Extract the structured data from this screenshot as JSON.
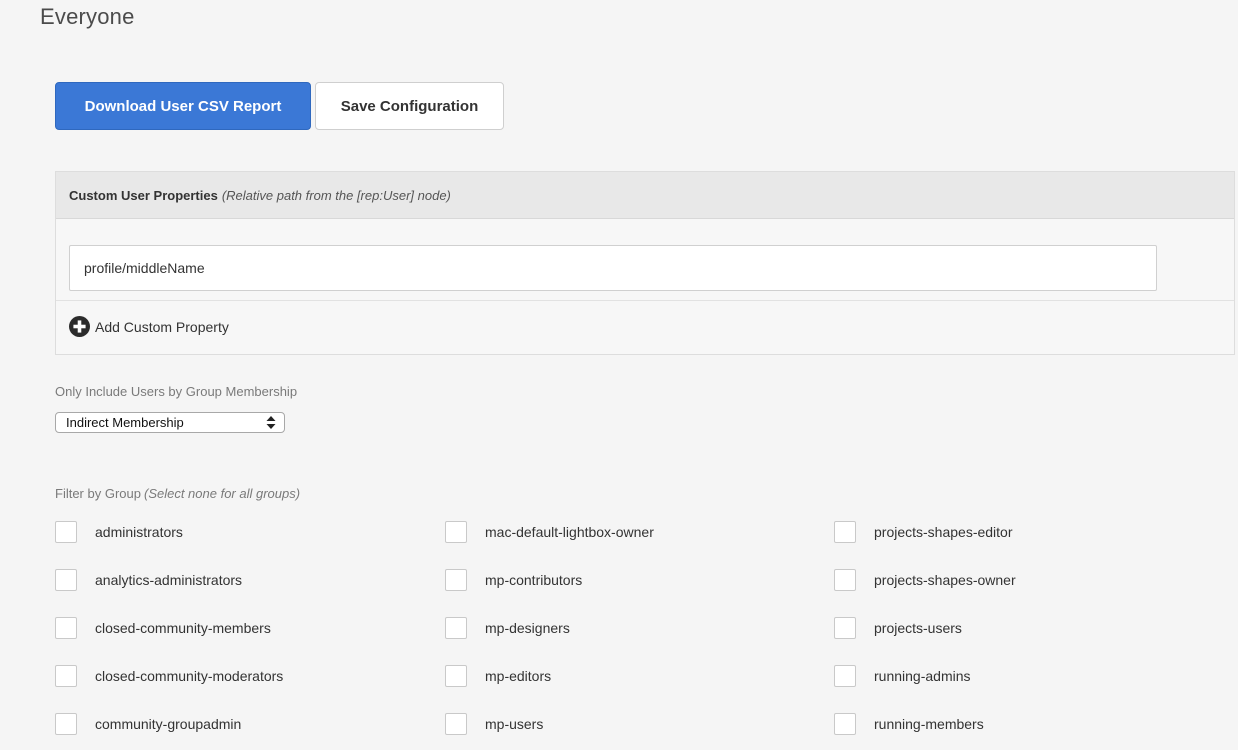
{
  "page": {
    "title": "Everyone"
  },
  "actions": {
    "download_label": "Download User CSV Report",
    "save_label": "Save Configuration"
  },
  "custom_properties": {
    "title": "Custom User Properties",
    "hint": "(Relative path from the [rep:User] node)",
    "value": "profile/middleName",
    "add_label": "Add Custom Property"
  },
  "membership": {
    "label": "Only Include Users by Group Membership",
    "selected": "Indirect Membership"
  },
  "filter": {
    "label": "Filter by Group",
    "hint": "(Select none for all groups)",
    "columns": [
      [
        "administrators",
        "analytics-administrators",
        "closed-community-members",
        "closed-community-moderators",
        "community-groupadmin"
      ],
      [
        "mac-default-lightbox-owner",
        "mp-contributors",
        "mp-designers",
        "mp-editors",
        "mp-users"
      ],
      [
        "projects-shapes-editor",
        "projects-shapes-owner",
        "projects-users",
        "running-admins",
        "running-members"
      ]
    ]
  },
  "colors": {
    "primary": "#3b78d6",
    "background": "#f5f5f5"
  }
}
